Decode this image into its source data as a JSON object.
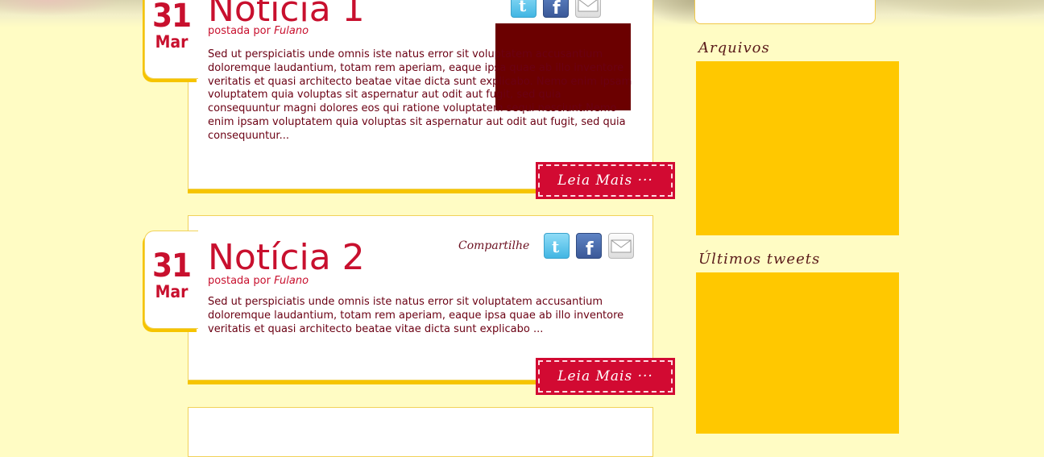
{
  "posts": [
    {
      "day": "31",
      "month": "Mar",
      "title": "Notícia 1",
      "byline_prefix": "postada por",
      "author": "Fulano",
      "excerpt": "Sed ut perspiciatis unde omnis iste natus error sit voluptatem accusantium doloremque laudantium, totam rem aperiam, eaque ipsa quae ab illo inventore veritatis et quasi architecto beatae vitae dicta sunt explicabo. Nemo enim ipsam voluptatem quia voluptas sit aspernatur aut odit aut fugit, sed quia consequuntur magni dolores eos qui ratione voluptatem sequi nesciunt.Nemo enim ipsam voluptatem quia voluptas sit aspernatur aut odit aut fugit, sed quia consequuntur...",
      "read_more": "Leia Mais ···",
      "thumbnail_color": "#6b0000"
    },
    {
      "day": "31",
      "month": "Mar",
      "title": "Notícia 2",
      "byline_prefix": "postada por",
      "author": "Fulano",
      "share_label": "Compartilhe",
      "excerpt": "Sed ut perspiciatis unde omnis iste natus error sit voluptatem accusantium doloremque laudantium, totam rem aperiam, eaque ipsa quae ab illo inventore veritatis et quasi architecto beatae vitae dicta sunt explicabo ...",
      "read_more": "Leia Mais ···"
    }
  ],
  "share_icons": [
    "twitter-icon",
    "facebook-icon",
    "mail-icon"
  ],
  "sidebar": {
    "archives_title": "Arquivos",
    "tweets_title": "Últimos tweets"
  },
  "colors": {
    "background": "#fffcc4",
    "accent": "#c8102e",
    "sidebar_panel": "#ffc800",
    "button": "#d20a32",
    "text": "#6b0013"
  }
}
